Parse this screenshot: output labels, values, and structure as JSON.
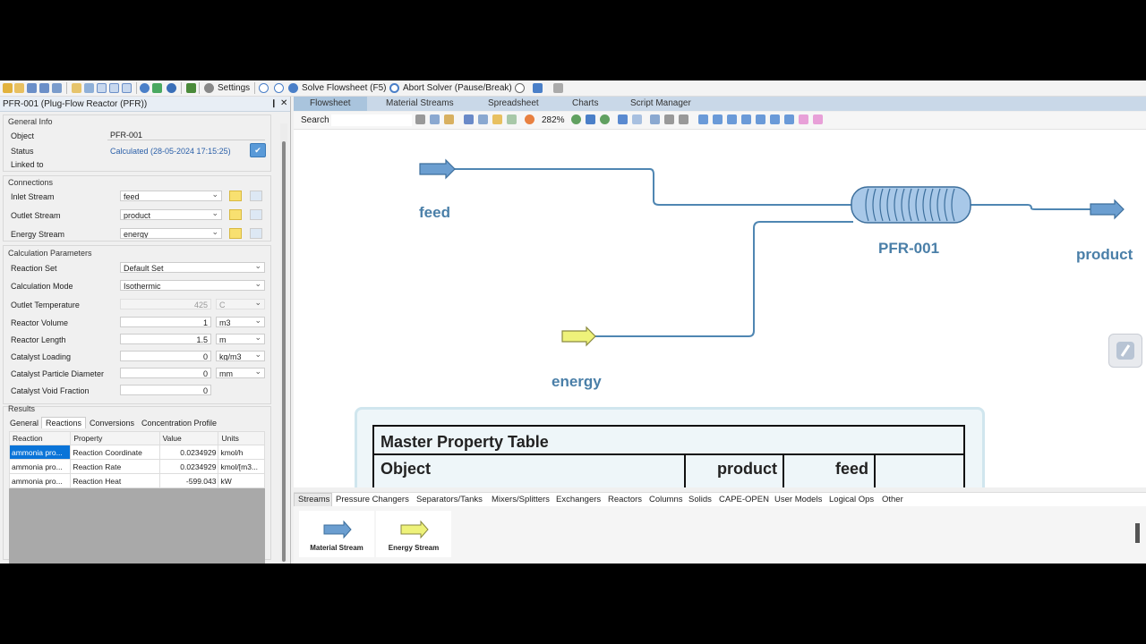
{
  "toolbar": {
    "settings": "Settings",
    "solve": "Solve Flowsheet (F5)",
    "abort": "Abort Solver (Pause/Break)"
  },
  "panel": {
    "title": "PFR-001 (Plug-Flow Reactor (PFR))",
    "pin": "❙",
    "close": "✕",
    "general_info": {
      "title": "General Info",
      "object_label": "Object",
      "object_value": "PFR-001",
      "status_label": "Status",
      "status_value": "Calculated (28-05-2024 17:15:25)",
      "linked_label": "Linked to"
    },
    "connections": {
      "title": "Connections",
      "inlet_label": "Inlet Stream",
      "inlet_value": "feed",
      "outlet_label": "Outlet Stream",
      "outlet_value": "product",
      "energy_label": "Energy Stream",
      "energy_value": "energy"
    },
    "calc": {
      "title": "Calculation Parameters",
      "reaction_set_label": "Reaction Set",
      "reaction_set_value": "Default Set",
      "mode_label": "Calculation Mode",
      "mode_value": "Isothermic",
      "outlet_temp_label": "Outlet Temperature",
      "outlet_temp_value": "425",
      "outlet_temp_unit": "C",
      "volume_label": "Reactor Volume",
      "volume_value": "1",
      "volume_unit": "m3",
      "length_label": "Reactor Length",
      "length_value": "1.5",
      "length_unit": "m",
      "cat_loading_label": "Catalyst Loading",
      "cat_loading_value": "0",
      "cat_loading_unit": "kg/m3",
      "cat_diam_label": "Catalyst Particle Diameter",
      "cat_diam_value": "0",
      "cat_diam_unit": "mm",
      "void_label": "Catalyst Void Fraction",
      "void_value": "0"
    },
    "results": {
      "title": "Results",
      "tabs": [
        "General",
        "Reactions",
        "Conversions",
        "Concentration Profile"
      ],
      "headers": [
        "Reaction",
        "Property",
        "Value",
        "Units"
      ],
      "rows": [
        [
          "ammonia pro...",
          "Reaction Coordinate",
          "0.0234929",
          "kmol/h"
        ],
        [
          "ammonia pro...",
          "Reaction Rate",
          "0.0234929",
          "kmol/[m3..."
        ],
        [
          "ammonia pro...",
          "Reaction Heat",
          "-599.043",
          "kW"
        ]
      ]
    }
  },
  "main_tabs": [
    "Flowsheet",
    "Material Streams",
    "Spreadsheet",
    "Charts",
    "Script Manager"
  ],
  "search_label": "Search",
  "zoom": "282%",
  "flowsheet": {
    "feed": "feed",
    "product": "product",
    "energy": "energy",
    "reactor": "PFR-001"
  },
  "master_table": {
    "title": "Master Property Table",
    "object": "Object",
    "col_product": "product",
    "col_feed": "feed"
  },
  "palette_tabs": [
    "Streams",
    "Pressure Changers",
    "Separators/Tanks",
    "Mixers/Splitters",
    "Exchangers",
    "Reactors",
    "Columns",
    "Solids",
    "CAPE-OPEN",
    "User Models",
    "Logical Ops",
    "Other"
  ],
  "palette_items": [
    "Material Stream",
    "Energy Stream"
  ],
  "colors": {
    "stream_blue": "#5b8fc0",
    "energy_yellow": "#eef27a",
    "label_blue": "#4a7fa8",
    "selected_row": "#0a74d8"
  }
}
